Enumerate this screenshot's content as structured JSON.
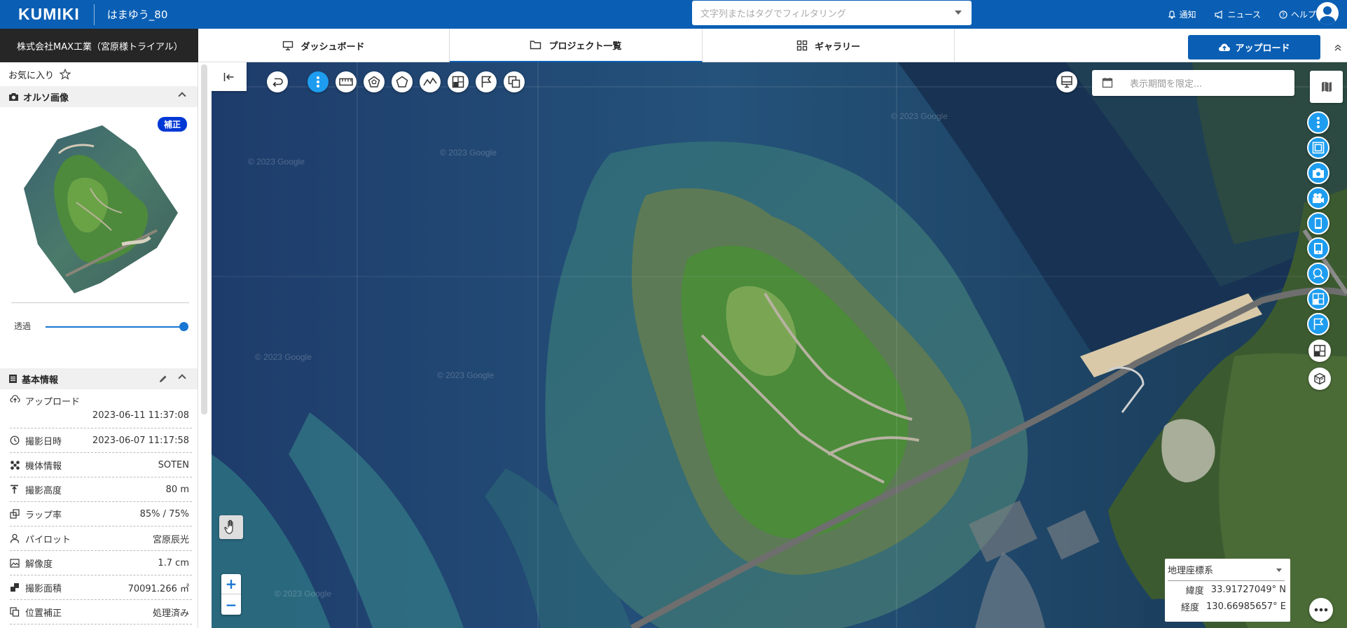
{
  "header": {
    "logo": "KUMIKI",
    "project_name": "はまゆう_80",
    "filter_placeholder": "文字列またはタグでフィルタリング",
    "links": {
      "notify": "通知",
      "news": "ニュース",
      "help": "ヘルプ"
    }
  },
  "subbar": {
    "company": "株式会社MAX工業（宮原様トライアル）",
    "tabs": {
      "dashboard": "ダッシュボード",
      "projects": "プロジェクト一覧",
      "gallery": "ギャラリー"
    },
    "upload": "アップロード"
  },
  "sidebar": {
    "favorites": "お気に入り",
    "ortho": {
      "title": "オルソ画像",
      "badge": "補正",
      "opacity_label": "透過",
      "opacity_value": 1.0
    },
    "basic": {
      "title": "基本情報",
      "rows": [
        {
          "label": "アップロード",
          "value": "2023-06-11 11:37:08"
        },
        {
          "label": "撮影日時",
          "value": "2023-06-07 11:17:58"
        },
        {
          "label": "機体情報",
          "value": "SOTEN"
        },
        {
          "label": "撮影高度",
          "value": "80 m"
        },
        {
          "label": "ラップ率",
          "value": "85% / 75%"
        },
        {
          "label": "パイロット",
          "value": "宮原辰光"
        },
        {
          "label": "解像度",
          "value": "1.7 cm"
        },
        {
          "label": "撮影面積",
          "value": "70091.266 ㎡"
        },
        {
          "label": "位置補正",
          "value": "処理済み"
        }
      ]
    }
  },
  "map": {
    "date_placeholder": "表示期間を限定...",
    "watermark": "© 2023 Google",
    "zoom_in": "+",
    "zoom_out": "−",
    "coords": {
      "system": "地理座標系",
      "lat_label": "緯度",
      "lat": "33.91727049° N",
      "lon_label": "経度",
      "lon": "130.66985657° E"
    }
  },
  "colors": {
    "brand": "#0a5fb4",
    "accent": "#1e9df0",
    "badge": "#0038d6"
  }
}
